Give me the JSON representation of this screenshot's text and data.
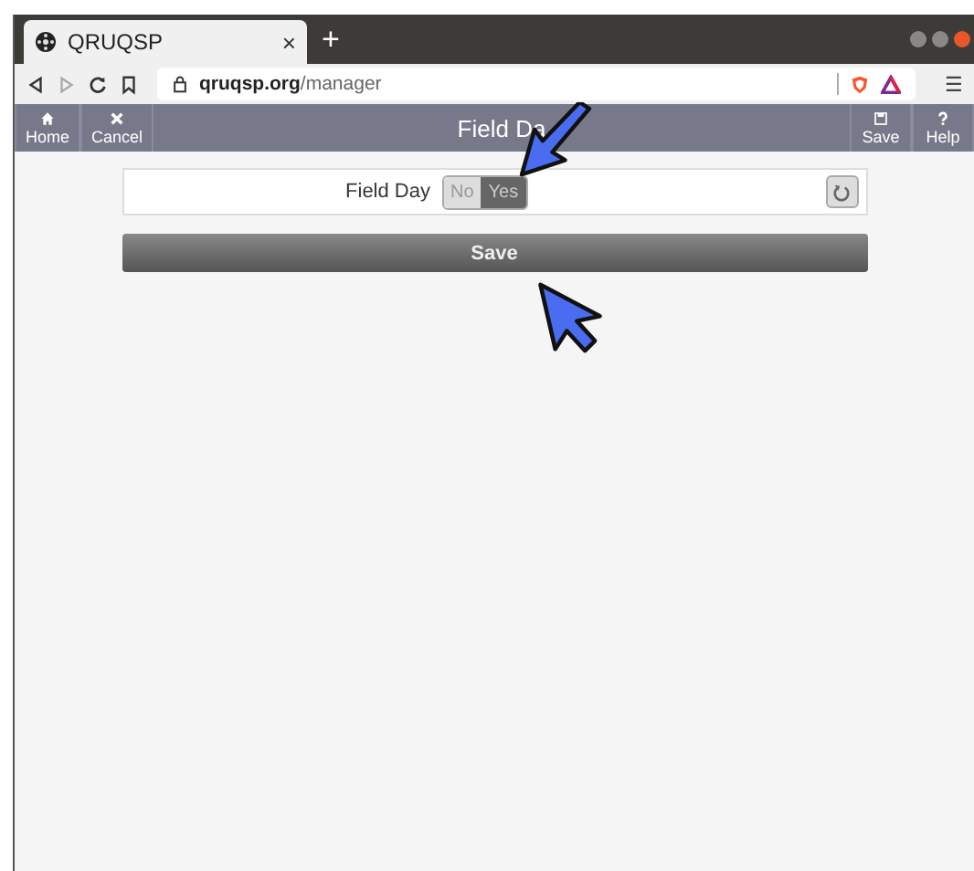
{
  "browser": {
    "tab_title": "QRUQSP",
    "tab_close": "×",
    "new_tab": "+",
    "url_host": "qruqsp.org",
    "url_path": "/manager",
    "menu": "☰"
  },
  "app_header": {
    "left_buttons": [
      {
        "kind": "home",
        "label": "Home"
      },
      {
        "kind": "cancel",
        "label": "Cancel"
      }
    ],
    "title": "Field Da",
    "right_buttons": [
      {
        "kind": "save",
        "label": "Save"
      },
      {
        "kind": "help",
        "label": "Help"
      }
    ]
  },
  "form": {
    "field_label": "Field Day",
    "options": [
      {
        "label": "No",
        "selected": false
      },
      {
        "label": "Yes",
        "selected": true
      }
    ]
  },
  "save_button": "Save"
}
